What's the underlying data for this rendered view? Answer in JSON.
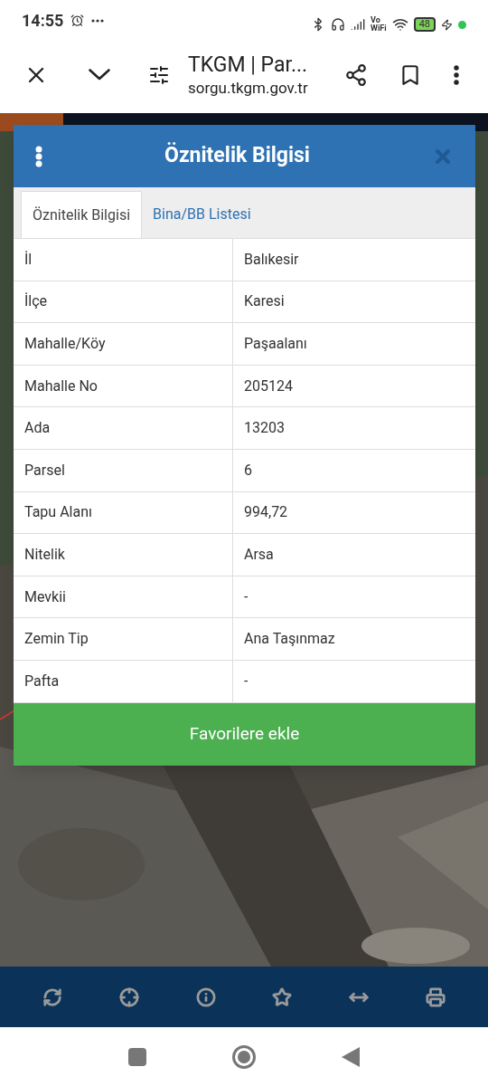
{
  "status_bar": {
    "time": "14:55",
    "wifi_label": [
      "Vo",
      "WiFi"
    ],
    "battery": "48"
  },
  "browser": {
    "title": "TKGM | Par...",
    "url": "sorgu.tkgm.gov.tr"
  },
  "dialog": {
    "title": "Öznitelik Bilgisi",
    "tabs": [
      {
        "label": "Öznitelik Bilgisi",
        "selected": true
      },
      {
        "label": "Bina/BB Listesi",
        "selected": false
      }
    ],
    "rows": [
      {
        "label": "İl",
        "value": "Balıkesir"
      },
      {
        "label": "İlçe",
        "value": "Karesi"
      },
      {
        "label": "Mahalle/Köy",
        "value": "Paşaalanı"
      },
      {
        "label": "Mahalle No",
        "value": "205124"
      },
      {
        "label": "Ada",
        "value": "13203"
      },
      {
        "label": "Parsel",
        "value": "6"
      },
      {
        "label": "Tapu Alanı",
        "value": "994,72"
      },
      {
        "label": "Nitelik",
        "value": "Arsa"
      },
      {
        "label": "Mevkii",
        "value": "-"
      },
      {
        "label": "Zemin Tip",
        "value": "Ana Taşınmaz"
      },
      {
        "label": "Pafta",
        "value": "-"
      }
    ],
    "button": "Favorilere ekle"
  }
}
